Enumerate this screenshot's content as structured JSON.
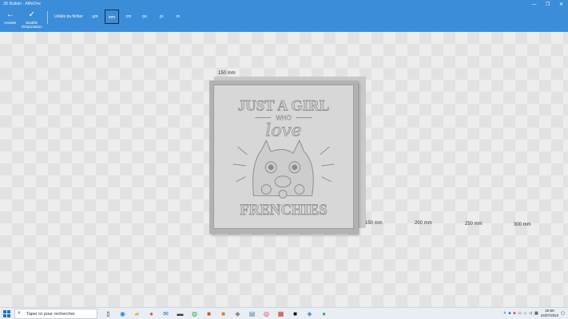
{
  "window": {
    "title": "3D Builder - AffinOne"
  },
  "window_controls": {
    "minimize": "—",
    "maximize": "❐",
    "close": "✕"
  },
  "toolbar": {
    "undo": {
      "icon": "←",
      "label": "Annuler"
    },
    "import": {
      "icon": "✓",
      "label_line1": "Modèle",
      "label_line2": "d'importation"
    },
    "units_label": "Unités du fichier",
    "units": [
      "µm",
      "mm",
      "cm",
      "po",
      "pi",
      "m"
    ],
    "selected_unit": "mm"
  },
  "viewport": {
    "rulers": [
      "150 mm",
      "150 mm",
      "200 mm",
      "250 mm",
      "300 mm"
    ]
  },
  "model_art": {
    "line1": "JUST A GIRL",
    "line2": "WHO",
    "line3": "love",
    "line4": "FRENCHIES"
  },
  "taskbar": {
    "search_placeholder": "Taper ici pour rechercher",
    "time": "20:59",
    "date": "24/07/2024"
  },
  "colors": {
    "toolbar": "#3c8dd9",
    "taskbar": "#e9eef4"
  }
}
